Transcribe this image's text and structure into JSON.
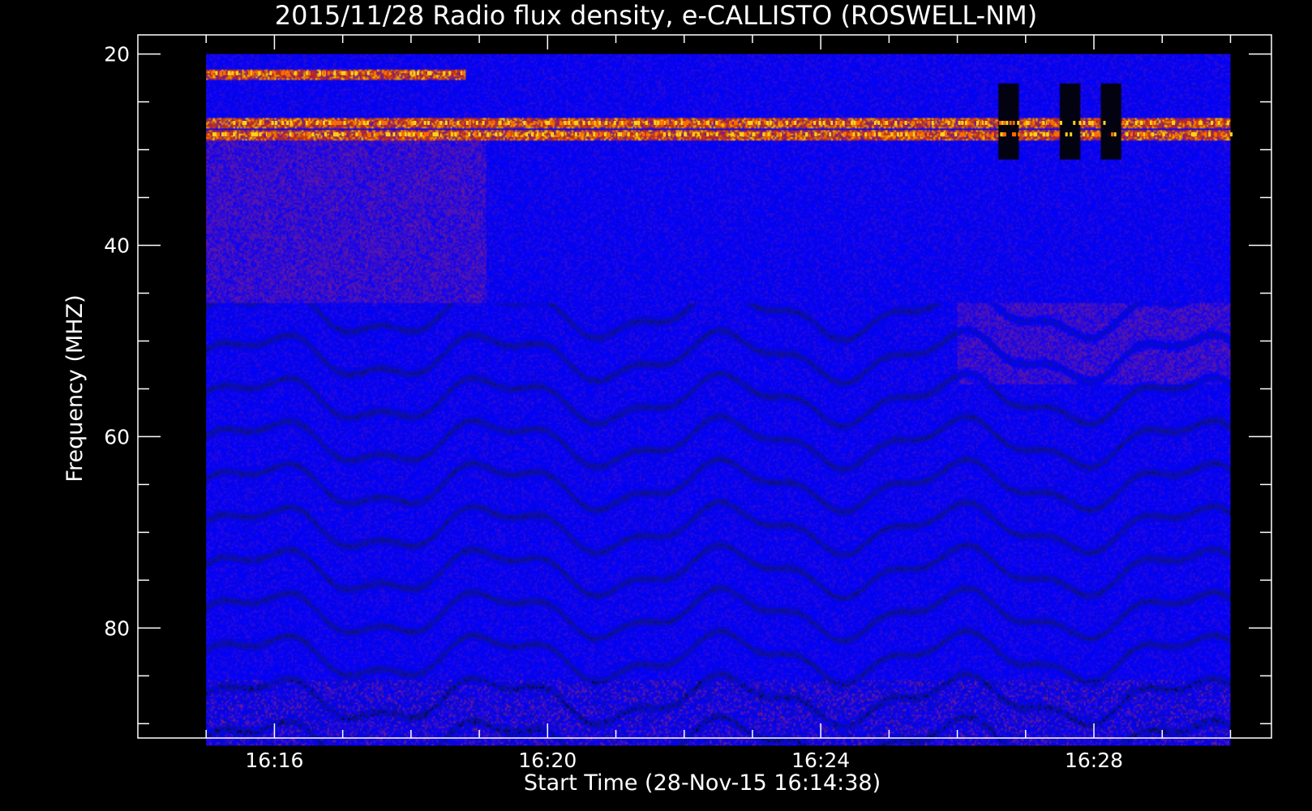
{
  "chart_data": {
    "type": "heatmap",
    "title": "2015/11/28  Radio flux density, e-CALLISTO (ROSWELL-NM)",
    "xlabel": "Start Time (28-Nov-15 16:14:38)",
    "ylabel": "Frequency (MHZ)",
    "x_tick_labels": [
      "16:16",
      "16:20",
      "16:24",
      "16:28"
    ],
    "x_ticks_minutes": [
      16,
      20,
      24,
      28
    ],
    "x_minor_ticks_minutes": [
      15,
      16,
      17,
      18,
      19,
      20,
      21,
      22,
      23,
      24,
      25,
      26,
      27,
      28,
      29,
      30
    ],
    "y_tick_labels": [
      "20",
      "40",
      "60",
      "80"
    ],
    "y_ticks": [
      20,
      40,
      60,
      80
    ],
    "y_minor_ticks": [
      20,
      25,
      30,
      35,
      40,
      45,
      50,
      55,
      60,
      65,
      70,
      75,
      80,
      85,
      90
    ],
    "xlim_minutes": [
      14.0,
      30.6
    ],
    "ylim": [
      91.5,
      18.0
    ],
    "data_time_range_minutes": [
      15.0,
      30.0
    ],
    "data_freq_range": [
      20.0,
      92.3
    ],
    "colormap": [
      "#000000",
      "#1010a0",
      "#0000ff",
      "#6a1a9a",
      "#d03000",
      "#ffd000"
    ],
    "features": [
      {
        "name": "narrowband interference",
        "freq": 22.0,
        "t_range": [
          15.0,
          18.8
        ],
        "level": "high"
      },
      {
        "name": "narrowband interference",
        "freq": 27.2,
        "t_range": [
          15.0,
          30.0
        ],
        "level": "high"
      },
      {
        "name": "narrowband interference",
        "freq": 28.4,
        "t_range": [
          15.0,
          30.0
        ],
        "level": "high"
      },
      {
        "name": "elevated background",
        "freq_range": [
          29.0,
          46.0
        ],
        "t_range": [
          15.0,
          19.1
        ],
        "level": "medium"
      },
      {
        "name": "elevated background",
        "freq_range": [
          46.0,
          54.5
        ],
        "t_range": [
          26.0,
          30.0
        ],
        "level": "medium"
      },
      {
        "name": "data gap",
        "freq_range": [
          23.0,
          31.0
        ],
        "t_range": [
          26.6,
          26.9
        ]
      },
      {
        "name": "data gap",
        "freq_range": [
          23.0,
          31.0
        ],
        "t_range": [
          27.5,
          27.8
        ]
      },
      {
        "name": "data gap",
        "freq_range": [
          23.0,
          31.0
        ],
        "t_range": [
          28.1,
          28.4
        ]
      }
    ],
    "grid": false,
    "legend": "none"
  }
}
